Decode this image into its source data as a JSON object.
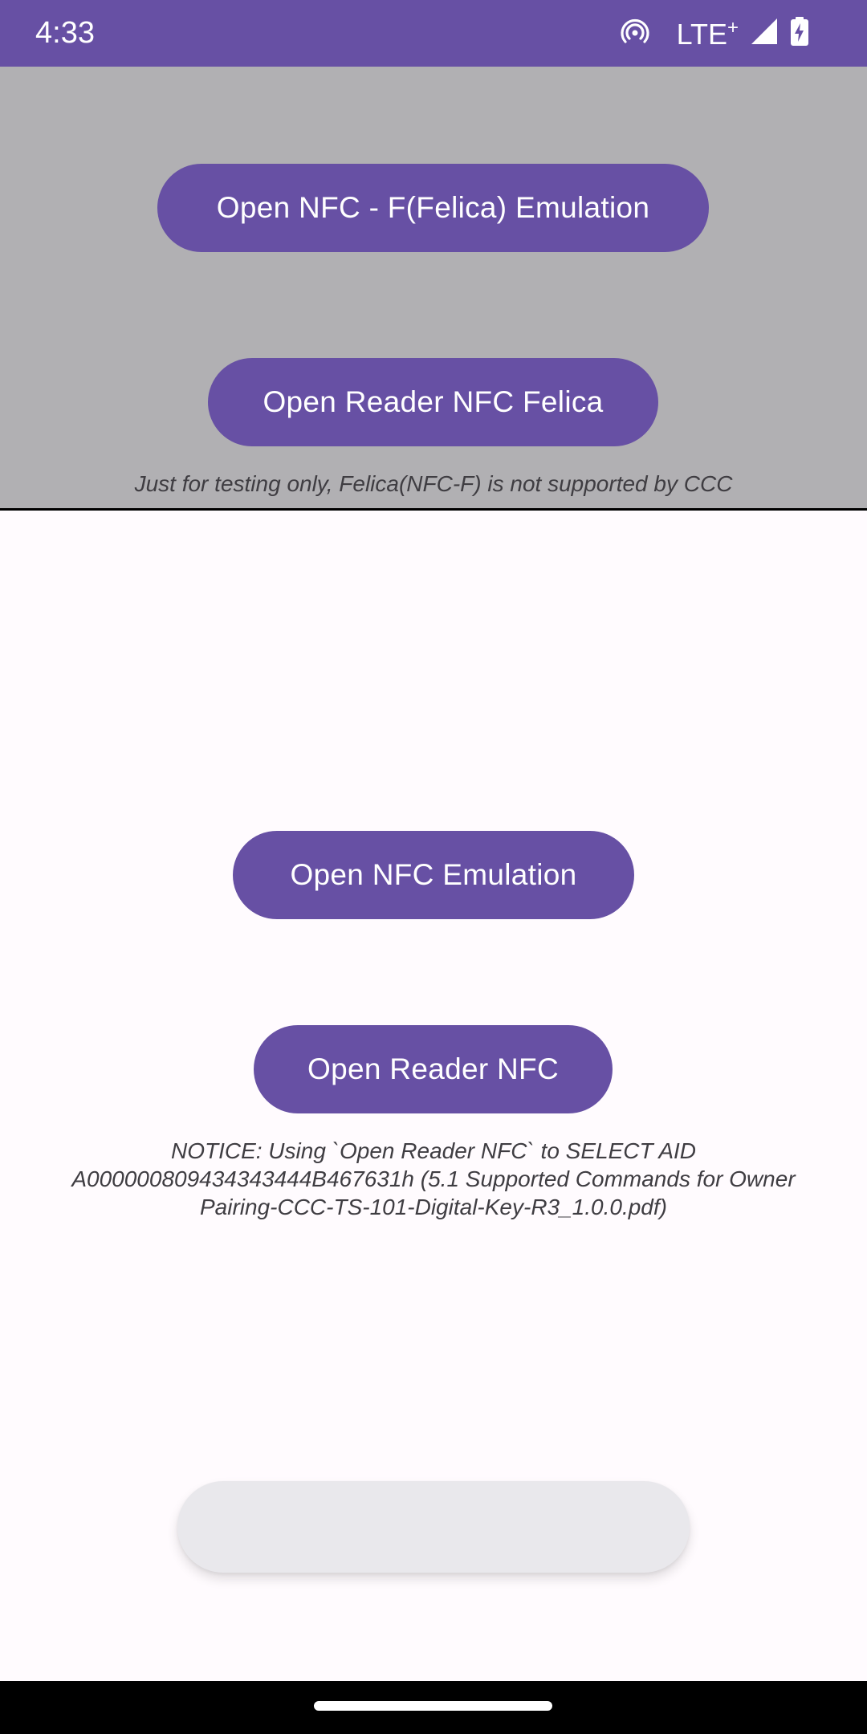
{
  "status_bar": {
    "time": "4:33",
    "network_label": "LTE",
    "network_suffix": "+",
    "icons": [
      "hotspot-icon",
      "signal-icon",
      "battery-charging-icon"
    ],
    "background_color": "#6750a4"
  },
  "felica_section": {
    "emulation_button_label": "Open NFC - F(Felica) Emulation",
    "reader_button_label": "Open Reader NFC Felica",
    "note": "Just for testing only, Felica(NFC-F) is not supported by CCC",
    "background_color": "#b1b0b3"
  },
  "nfc_section": {
    "emulation_button_label": "Open NFC Emulation",
    "reader_button_label": "Open Reader NFC",
    "notice_lines": [
      "NOTICE: Using `Open Reader NFC` to SELECT AID",
      "A000000809434343444B467631h (5.1 Supported Commands for Owner",
      "Pairing-CCC-TS-101-Digital-Key-R3_1.0.0.pdf)"
    ]
  },
  "colors": {
    "accent": "#6750a4",
    "page_background": "#fffbfe",
    "snackbar": "#e9e8ec"
  }
}
